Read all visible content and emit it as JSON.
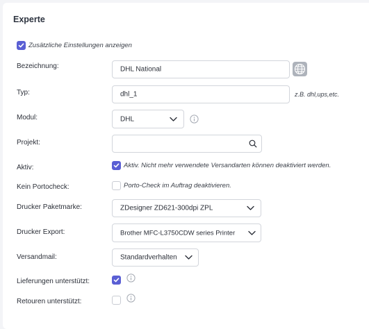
{
  "section": {
    "title": "Experte"
  },
  "show_additional": {
    "label": "Zusätzliche Einstellungen anzeigen",
    "checked": true
  },
  "form": {
    "bezeichnung": {
      "label": "Bezeichnung:",
      "value": "DHL National",
      "icon": "globe-icon"
    },
    "typ": {
      "label": "Typ:",
      "value": "dhl_1",
      "hint": "z.B. dhl,ups,etc."
    },
    "modul": {
      "label": "Modul:",
      "selected": "DHL",
      "icon": "info-icon"
    },
    "projekt": {
      "label": "Projekt:",
      "value": "",
      "icon": "search-icon"
    },
    "aktiv": {
      "label": "Aktiv:",
      "checked": true,
      "description": "Aktiv. Nicht mehr verwendete Versandarten können deaktiviert werden."
    },
    "kein_portocheck": {
      "label": "Kein Portocheck:",
      "checked": false,
      "description": "Porto-Check im Auftrag deaktivieren."
    },
    "drucker_paketmarke": {
      "label": "Drucker Paketmarke:",
      "selected": "ZDesigner ZD621-300dpi ZPL"
    },
    "drucker_export": {
      "label": "Drucker Export:",
      "selected": "Brother MFC-L3750CDW series Printer"
    },
    "versandmail": {
      "label": "Versandmail:",
      "selected": "Standardverhalten"
    },
    "lieferungen": {
      "label": "Lieferungen unterstützt:",
      "checked": true,
      "icon": "info-icon"
    },
    "retouren": {
      "label": "Retouren unterstützt:",
      "checked": false,
      "icon": "info-icon"
    }
  },
  "colors": {
    "accent": "#5a5fd4",
    "border": "#d2d5db",
    "background": "#f3f4f7"
  }
}
